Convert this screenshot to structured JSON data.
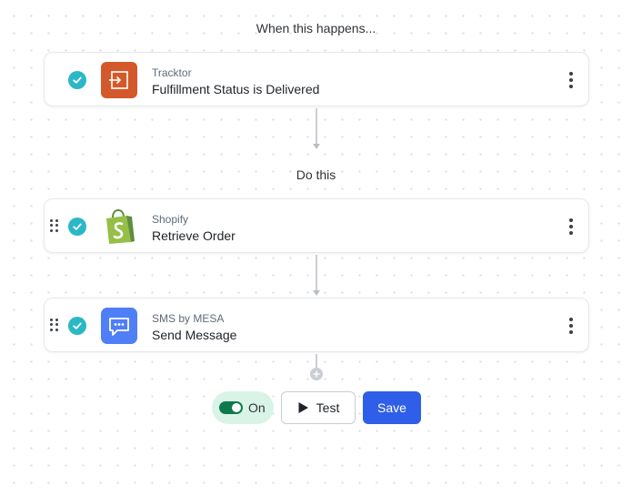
{
  "trigger_section": {
    "label": "When this happens..."
  },
  "action_section": {
    "label": "Do this"
  },
  "steps": [
    {
      "app_name": "Tracktor",
      "action": "Fulfillment Status is Delivered",
      "icon": "tracktor-app-icon",
      "icon_color": "#d3592a",
      "status": "complete",
      "draggable": false
    },
    {
      "app_name": "Shopify",
      "action": "Retrieve Order",
      "icon": "shopify-bag-icon",
      "icon_color": "#95bf47",
      "status": "complete",
      "draggable": true
    },
    {
      "app_name": "SMS by MESA",
      "action": "Send Message",
      "icon": "sms-chat-bubble-icon",
      "icon_color": "#4f7ff7",
      "status": "complete",
      "draggable": true
    }
  ],
  "controls": {
    "toggle_label": "On",
    "toggle_state": "on",
    "test_label": "Test",
    "save_label": "Save"
  },
  "colors": {
    "check": "#2bb7c6",
    "toggle_bg": "#d9f4e7",
    "toggle_track": "#0c7a4c",
    "save_button": "#2f5fe8",
    "connector": "#b9bec5"
  }
}
